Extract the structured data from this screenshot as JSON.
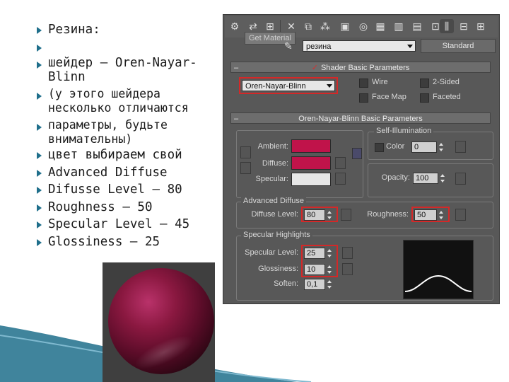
{
  "bullets": [
    {
      "text": "Резина:"
    },
    {
      "text": ""
    },
    {
      "text": "шейдер — Oren-Nayar-Blinn"
    },
    {
      "text": "(у этого шейдера несколько отличаются"
    },
    {
      "text": "параметры, будьте внимательны)"
    },
    {
      "text": "цвет выбираем свой"
    },
    {
      "text": "Advanced Diffuse"
    },
    {
      "text": "Difusse Level — 80"
    },
    {
      "text": "Roughness — 50"
    },
    {
      "text": "Specular Level — 45"
    },
    {
      "text": "Glossiness — 25"
    }
  ],
  "panel": {
    "tooltip": "Get Material",
    "material_name": "резина",
    "material_type": "Standard",
    "shader_rollout": "Shader Basic Parameters",
    "shader_value": "Oren-Nayar-Blinn",
    "wire": "Wire",
    "two_sided": "2-Sided",
    "face_map": "Face Map",
    "faceted": "Faceted",
    "basic_rollout": "Oren-Nayar-Blinn Basic Parameters",
    "self_illum": "Self-Illumination",
    "color_label": "Color",
    "color_value": "0",
    "ambient": "Ambient:",
    "diffuse": "Diffuse:",
    "specular": "Specular:",
    "opacity_label": "Opacity:",
    "opacity_value": "100",
    "adv_diffuse": "Advanced Diffuse",
    "diffuse_level_label": "Diffuse Level:",
    "diffuse_level_value": "80",
    "roughness_label": "Roughness:",
    "roughness_value": "50",
    "spec_highlights": "Specular Highlights",
    "spec_level_label": "Specular Level:",
    "spec_level_value": "25",
    "gloss_label": "Glossiness:",
    "gloss_value": "10",
    "soften_label": "Soften:",
    "soften_value": "0,1"
  },
  "colors": {
    "ambient": "#c0134a",
    "diffuse": "#c0134a",
    "specular": "#e6e6e6",
    "highlight_box": "#d42828",
    "bullet": "#1f6f8b"
  }
}
